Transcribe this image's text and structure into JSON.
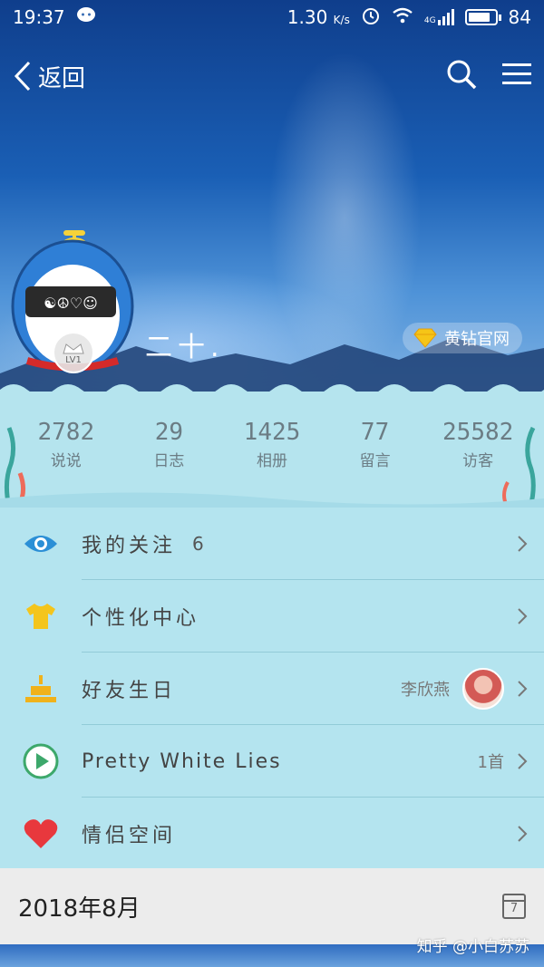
{
  "status_bar": {
    "time": "19:37",
    "speed": "1.30",
    "speed_unit": "K/s",
    "network": "4G",
    "battery": "84"
  },
  "nav": {
    "back_label": "返回"
  },
  "profile": {
    "name": "二十.",
    "level": "LV1",
    "vip_label": "黄钻官网"
  },
  "stats": [
    {
      "value": "2782",
      "label": "说说"
    },
    {
      "value": "29",
      "label": "日志"
    },
    {
      "value": "1425",
      "label": "相册"
    },
    {
      "value": "77",
      "label": "留言"
    },
    {
      "value": "25582",
      "label": "访客"
    }
  ],
  "menu": {
    "following": {
      "label": "我的关注",
      "count": "6"
    },
    "personalize": {
      "label": "个性化中心"
    },
    "birthday": {
      "label": "好友生日",
      "friend": "李欣燕"
    },
    "music": {
      "label": "Pretty White Lies",
      "count": "1首"
    },
    "couple": {
      "label": "情侣空间"
    }
  },
  "date_header": {
    "date": "2018年8月",
    "calendar_day": "7"
  },
  "watermark": "知乎 @小白苏苏",
  "colors": {
    "eye": "#2b8fd6",
    "shirt": "#f4c51c",
    "cake": "#f0b21b",
    "play": "#3da86b",
    "heart": "#e8383d"
  }
}
